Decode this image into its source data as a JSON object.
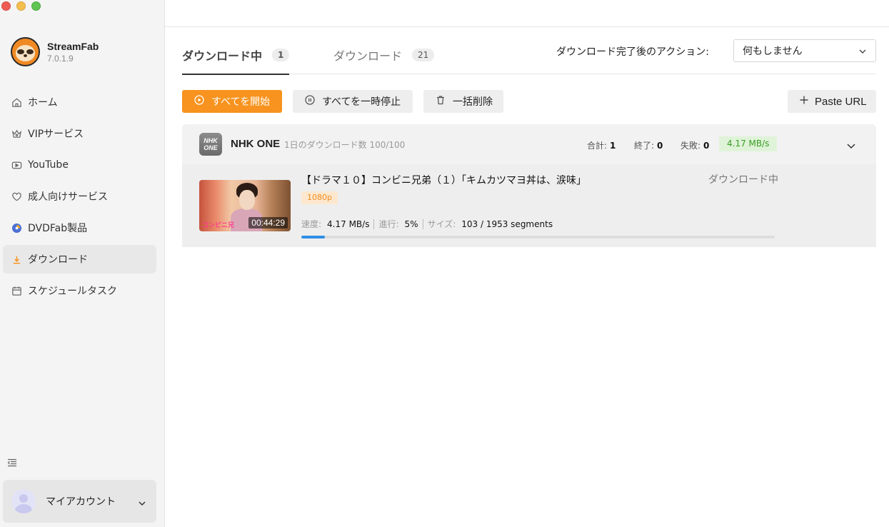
{
  "app": {
    "name": "StreamFab",
    "version": "7.0.1.9"
  },
  "sidebar": {
    "items": [
      {
        "label": "ホーム",
        "icon": "home-icon"
      },
      {
        "label": "VIPサービス",
        "icon": "crown-icon"
      },
      {
        "label": "YouTube",
        "icon": "youtube-icon"
      },
      {
        "label": "成人向けサービス",
        "icon": "heart-icon"
      },
      {
        "label": "DVDFab製品",
        "icon": "dvdfab-icon"
      },
      {
        "label": "ダウンロード",
        "icon": "download-icon",
        "active": true
      },
      {
        "label": "スケジュールタスク",
        "icon": "calendar-icon"
      }
    ],
    "account_label": "マイアカウント"
  },
  "tabs": [
    {
      "label": "ダウンロード中",
      "count": "1",
      "active": true
    },
    {
      "label": "ダウンロード",
      "count": "21",
      "active": false
    }
  ],
  "after_download": {
    "label": "ダウンロード完了後のアクション:",
    "selected": "何もしません"
  },
  "toolbar": {
    "start_all": "すべてを開始",
    "pause_all": "すべてを一時停止",
    "delete_all": "一括削除",
    "paste_url": "Paste URL"
  },
  "group": {
    "site_logo_text": "NHK ONE",
    "site_name": "NHK ONE",
    "quota": "1日のダウンロード数 100/100",
    "total_label": "合計:",
    "total_value": "1",
    "done_label": "終了:",
    "done_value": "0",
    "fail_label": "失敗:",
    "fail_value": "0",
    "speed": "4.17 MB/s"
  },
  "item": {
    "title": "【ドラマ１０】コンビニ兄弟（１）「キムカツマヨ丼は、涙味」",
    "status": "ダウンロード中",
    "resolution": "1080p",
    "duration": "00:44:29",
    "thumb_text": "コンビニ兄",
    "speed_label": "速度:",
    "speed_value": "4.17 MB/s",
    "progress_label": "進行:",
    "progress_value": "5%",
    "progress_fraction": 0.05,
    "size_label": "サイズ:",
    "size_value": "103 / 1953 segments"
  },
  "colors": {
    "accent": "#f7931e",
    "progress": "#2f8ee5",
    "speed_badge_text": "#3a9d24",
    "speed_badge_bg": "#dff3d8"
  }
}
